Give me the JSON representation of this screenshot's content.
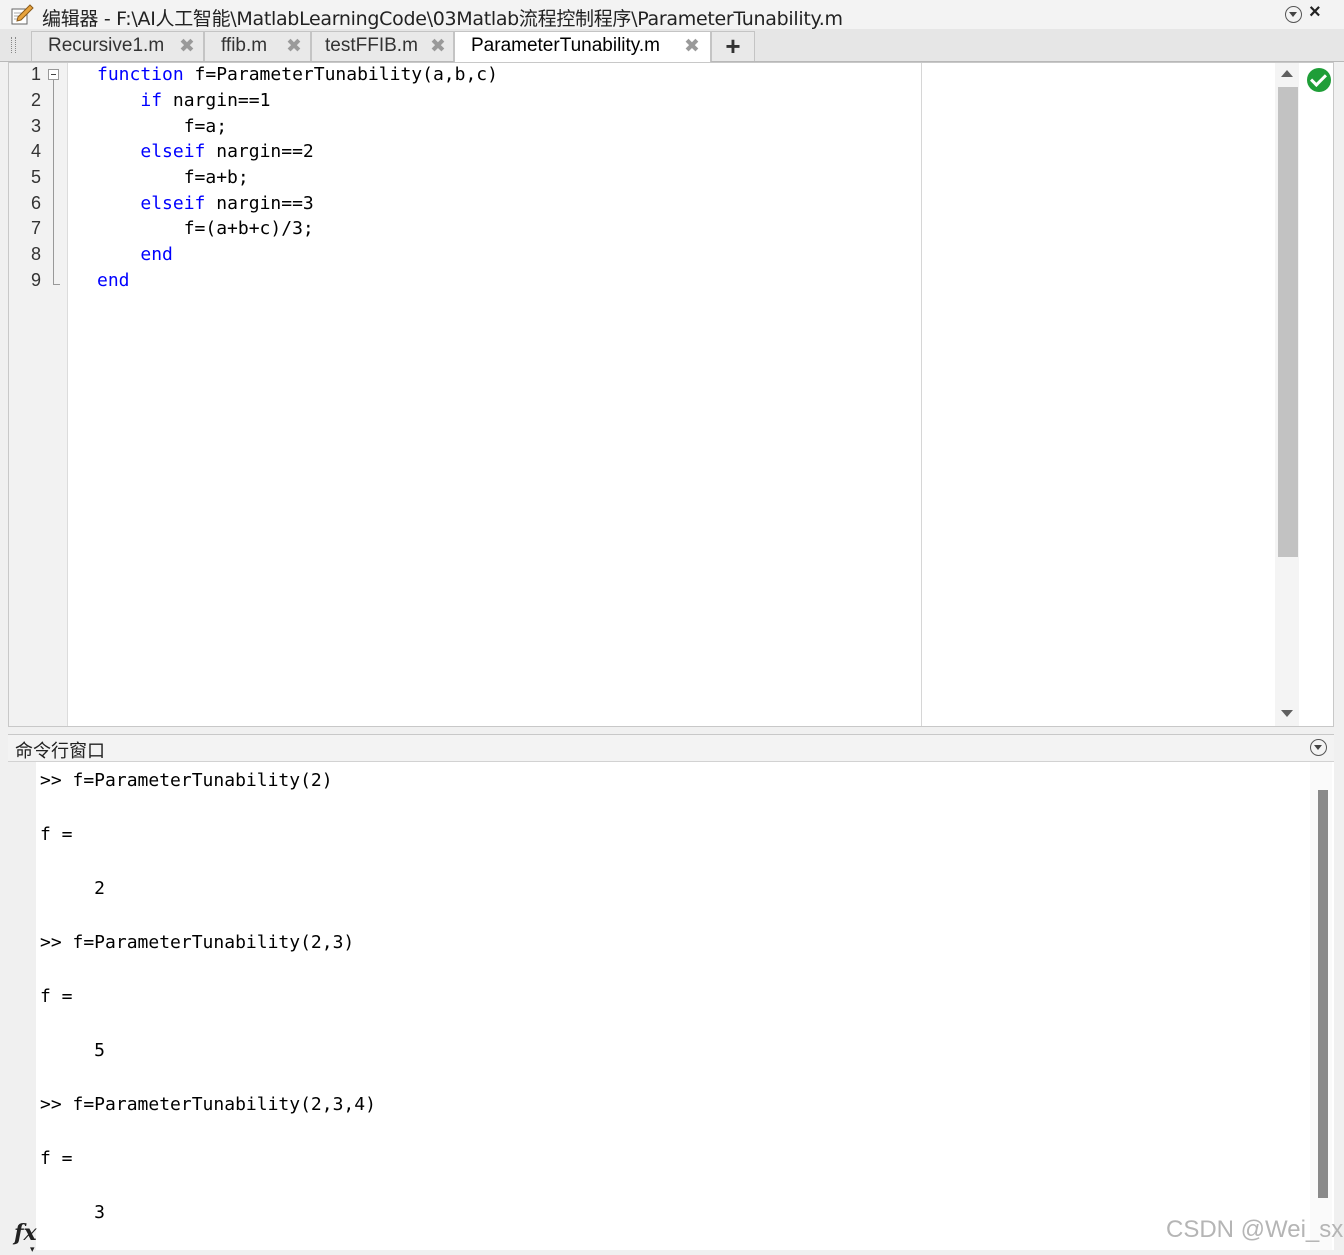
{
  "window": {
    "title": "编辑器 - F:\\AI人工智能\\MatlabLearningCode\\03Matlab流程控制程序\\ParameterTunability.m",
    "close_glyph": "×"
  },
  "tabs": [
    {
      "label": "Recursive1.m",
      "active": false
    },
    {
      "label": "ffib.m",
      "active": false
    },
    {
      "label": "testFFIB.m",
      "active": false
    },
    {
      "label": "ParameterTunability.m",
      "active": true
    }
  ],
  "tab_close_glyph": "✖",
  "tab_add_glyph": "+",
  "editor": {
    "line_numbers": [
      "1",
      "2",
      "3",
      "4",
      "5",
      "6",
      "7",
      "8",
      "9"
    ],
    "lines": [
      {
        "indent": "",
        "kw": "function",
        "rest": " f=ParameterTunability(a,b,c)"
      },
      {
        "indent": "    ",
        "kw": "if",
        "rest": " nargin==1"
      },
      {
        "indent": "        ",
        "kw": "",
        "rest": "f=a;"
      },
      {
        "indent": "    ",
        "kw": "elseif",
        "rest": " nargin==2"
      },
      {
        "indent": "        ",
        "kw": "",
        "rest": "f=a+b;"
      },
      {
        "indent": "    ",
        "kw": "elseif",
        "rest": " nargin==3"
      },
      {
        "indent": "        ",
        "kw": "",
        "rest": "f=(a+b+c)/3;"
      },
      {
        "indent": "    ",
        "kw": "end",
        "rest": ""
      },
      {
        "indent": "",
        "kw": "end",
        "rest": ""
      }
    ],
    "colors": {
      "keyword": "#0000ff",
      "status_ok": "#1f9e38"
    }
  },
  "command_window": {
    "title": "命令行窗口",
    "lines": [
      ">> f=ParameterTunability(2)",
      "",
      "f =",
      "",
      "     2",
      "",
      ">> f=ParameterTunability(2,3)",
      "",
      "f =",
      "",
      "     5",
      "",
      ">> f=ParameterTunability(2,3,4)",
      "",
      "f =",
      "",
      "     3"
    ],
    "fx_label": "fx"
  },
  "watermark": "CSDN @Wei_sx"
}
